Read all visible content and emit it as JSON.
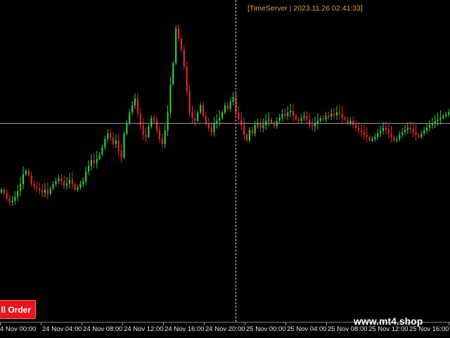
{
  "window": {
    "time_server": "[TimeServer | 2023.11.26 02:41:33]"
  },
  "panel": {
    "sell_label": "ll Order"
  },
  "watermark": "www.mt4.shop",
  "axis": {
    "labels": [
      "4 Nov 00:00",
      "24 Nov 04:00",
      "24 Nov 08:00",
      "24 Nov 12:00",
      "24 Nov 16:00",
      "24 Nov 20:00",
      "25 Nov 00:00",
      "25 Nov 04:00",
      "25 Nov 08:00",
      "25 Nov 12:00",
      "25 Nov 16:00",
      "25 N"
    ]
  },
  "colors": {
    "bull": "#2ecc40",
    "bear": "#e0282e",
    "axis_text": "#e8e8e8",
    "time_text": "#d8a24a",
    "sell_button": "#e8151b"
  },
  "series": {
    "close": [
      270,
      275,
      283,
      288,
      286,
      280,
      272,
      262,
      248,
      243,
      250,
      262,
      266,
      268,
      271,
      274,
      270,
      276,
      268,
      262,
      258,
      254,
      258,
      264,
      261,
      256,
      262,
      270,
      267,
      262,
      258,
      244,
      236,
      228,
      232,
      226,
      220,
      210,
      198,
      190,
      196,
      205,
      200,
      215,
      224,
      190,
      175,
      160,
      150,
      140,
      162,
      178,
      192,
      195,
      180,
      168,
      172,
      186,
      198,
      205,
      186,
      160,
      120,
      90,
      40,
      55,
      70,
      95,
      130,
      160,
      168,
      172,
      160,
      150,
      165,
      175,
      182,
      188,
      176,
      172,
      168,
      160,
      150,
      155,
      145,
      138,
      160,
      170,
      178,
      192,
      200,
      185,
      190,
      178,
      176,
      182,
      178,
      172,
      170,
      175,
      180,
      172,
      168,
      162,
      165,
      160,
      158,
      165,
      170,
      172,
      168,
      165,
      170,
      178,
      180,
      176,
      172,
      168,
      170,
      165,
      166,
      162,
      164,
      160,
      162,
      168,
      170,
      175,
      172,
      178,
      182,
      186,
      188,
      192,
      195,
      200,
      198,
      195,
      190,
      186,
      182,
      185,
      190,
      195,
      200,
      198,
      192,
      188,
      185,
      182,
      184,
      188,
      192,
      195,
      190,
      186,
      182,
      178,
      176,
      172,
      170,
      168,
      165,
      163,
      160
    ]
  }
}
